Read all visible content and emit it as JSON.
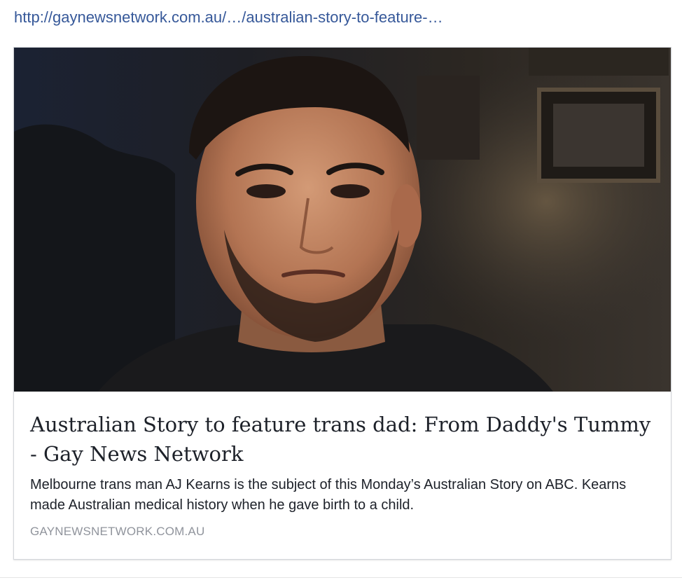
{
  "post": {
    "link_text": "http://gaynewsnetwork.com.au/…/australian-story-to-feature-…"
  },
  "link_preview": {
    "image": {
      "alt": "Australian Story to feature trans dad: From Daddy's Tummy - Gay News Network"
    },
    "title": "Australian Story to feature trans dad: From Daddy's Tummy - Gay News Network",
    "description": "Melbourne trans man AJ Kearns is the subject of this Monday’s Australian Story on ABC. Kearns made Australian medical history when he gave birth to a child.",
    "domain": "GAYNEWSNETWORK.COM.AU"
  },
  "colors": {
    "link": "#365899",
    "title_text": "#1d2129",
    "domain_text": "#90949c",
    "card_border": "#d3d6db"
  }
}
